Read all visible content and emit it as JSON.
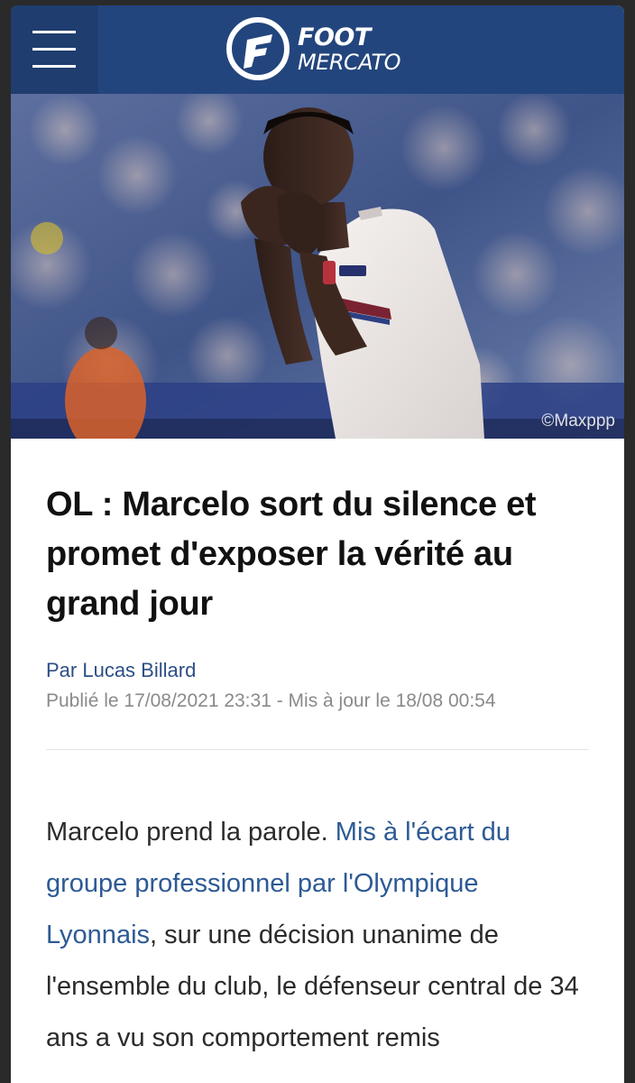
{
  "header": {
    "logo_line1": "FOOT",
    "logo_line2": "MERCATO",
    "brand_color": "#23457d",
    "menu_icon": "hamburger-menu-icon"
  },
  "hero": {
    "photo_credit": "©Maxppp"
  },
  "article": {
    "title": "OL : Marcelo sort du silence et promet d'exposer la vérité au grand jour",
    "author": "Par Lucas Billard",
    "published": "Publié le 17/08/2021 23:31 - Mis à jour le 18/08 00:54",
    "body": {
      "intro": "Marcelo prend la parole. ",
      "link_text": "Mis à l'écart du groupe professionnel par l'Olympique Lyonnais",
      "rest": ", sur une décision unanime de l'ensemble du club, le défenseur central de 34 ans a vu son comportement remis"
    }
  }
}
